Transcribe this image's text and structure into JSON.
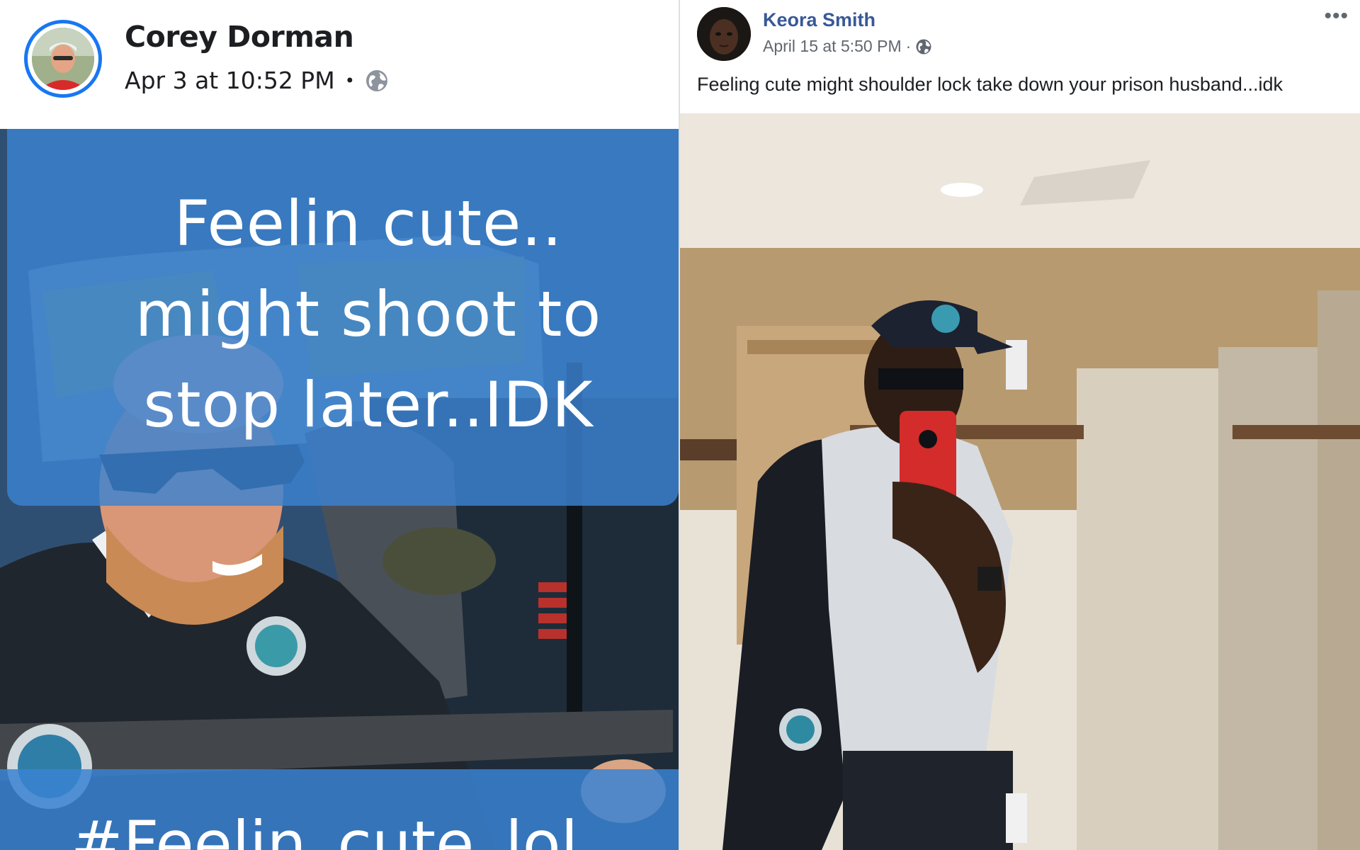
{
  "left_post": {
    "author": "Corey Dorman",
    "timestamp": "Apr 3 at 10:52 PM",
    "separator": "•",
    "privacy_icon": "globe-icon",
    "image_caption": "Feelin cute..\nmight shoot to\nstop later..IDK",
    "image_bottom_text": "#Feelin_cute_lol",
    "colors": {
      "avatar_ring": "#1877f2",
      "overlay": "#3a82d2"
    }
  },
  "right_post": {
    "author": "Keora Smith",
    "timestamp": "April 15 at 5:50 PM",
    "separator": "·",
    "privacy_icon": "globe-icon",
    "more_label": "•••",
    "text": "Feeling cute might shoulder lock take down your prison husband...idk",
    "colors": {
      "author": "#385898",
      "meta": "#606770"
    }
  }
}
